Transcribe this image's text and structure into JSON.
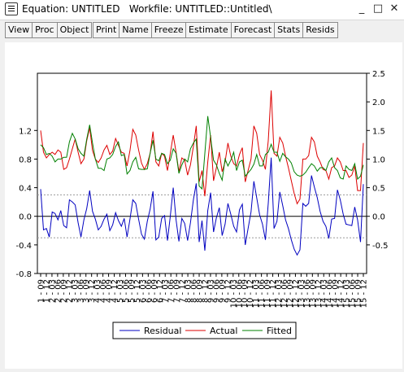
{
  "window": {
    "title": "Equation: UNTITLED   Workfile: UNTITLED::Untitled\\",
    "minimize_glyph": "_",
    "maximize_glyph": "□",
    "close_glyph": "✕"
  },
  "toolbar": {
    "group1": [
      "View",
      "Proc",
      "Object"
    ],
    "group2": [
      "Print",
      "Name",
      "Freeze"
    ],
    "group3": [
      "Estimate",
      "Forecast",
      "Stats",
      "Resids"
    ]
  },
  "colors": {
    "residual": "#0000c0",
    "actual": "#dd0000",
    "fitted": "#008000",
    "band": "#9a9a9a"
  },
  "chart_data": {
    "type": "line",
    "x_tick_labels": [
      "1 - 09",
      "1 - 12",
      "2 - 03",
      "2 - 06",
      "2 - 09",
      "2 - 12",
      "3 - 03",
      "3 - 06",
      "3 - 09",
      "3 - 12",
      "4 - 03",
      "4 - 06",
      "4 - 09",
      "4 - 12",
      "5 - 03",
      "5 - 06",
      "5 - 09",
      "5 - 12",
      "6 - 03",
      "6 - 06",
      "6 - 09",
      "6 - 12",
      "7 - 03",
      "7 - 06",
      "7 - 09",
      "7 - 12",
      "8 - 03",
      "8 - 06",
      "8 - 09",
      "8 - 12",
      "9 - 03",
      "9 - 06",
      "9 - 09",
      "9 - 12",
      "10 - 03",
      "10 - 06",
      "10 - 09",
      "10 - 12",
      "11 - 03",
      "11 - 06",
      "11 - 09",
      "11 - 12",
      "12 - 03",
      "12 - 06",
      "12 - 09",
      "12 - 12",
      "13 - 03",
      "13 - 06",
      "13 - 09",
      "13 - 12",
      "14 - 03",
      "14 - 06",
      "14 - 09",
      "14 - 12",
      "15 - 03",
      "15 - 06",
      "15 - 09",
      "15 - 12"
    ],
    "left_axis": {
      "ticks": [
        "1.2",
        "0.8",
        "0.4",
        "0.0",
        "-0.4",
        "-0.8"
      ],
      "ylim": [
        -0.8,
        2.0
      ]
    },
    "right_axis": {
      "ticks": [
        "2.5",
        "2.0",
        "1.5",
        "1.0",
        "0.5",
        "0.0",
        "-0.5"
      ],
      "ylim": [
        -1.0,
        2.5
      ]
    },
    "residual_band": [
      -0.3,
      0.3
    ],
    "series": [
      {
        "name": "Residual",
        "axis": "left",
        "values": [
          0.38,
          -0.19,
          -0.17,
          -0.29,
          0.06,
          0.04,
          -0.05,
          0.08,
          -0.13,
          -0.16,
          0.23,
          0.2,
          0.16,
          -0.09,
          -0.29,
          -0.05,
          0.11,
          0.36,
          0.07,
          -0.04,
          -0.19,
          -0.14,
          -0.04,
          0.03,
          -0.2,
          -0.12,
          0.05,
          -0.06,
          -0.14,
          -0.03,
          -0.29,
          -0.04,
          0.23,
          0.18,
          -0.04,
          -0.25,
          -0.32,
          -0.07,
          0.1,
          0.35,
          -0.33,
          -0.29,
          -0.03,
          0.01,
          -0.34,
          0.0,
          0.4,
          -0.05,
          -0.35,
          -0.03,
          -0.1,
          -0.34,
          -0.09,
          0.23,
          0.46,
          -0.36,
          -0.06,
          -0.48,
          0.08,
          0.33,
          -0.22,
          -0.02,
          0.12,
          -0.27,
          -0.11,
          0.18,
          0.03,
          -0.14,
          -0.22,
          0.09,
          0.17,
          -0.4,
          -0.17,
          0.06,
          0.49,
          0.26,
          0.02,
          -0.11,
          -0.33,
          0.18,
          0.82,
          -0.17,
          -0.07,
          0.34,
          0.15,
          -0.05,
          -0.17,
          -0.33,
          -0.46,
          -0.54,
          -0.47,
          0.18,
          0.14,
          0.18,
          0.57,
          0.41,
          0.26,
          0.07,
          -0.07,
          -0.14,
          -0.31,
          -0.04,
          -0.03,
          0.37,
          0.23,
          0.03,
          -0.11,
          -0.12,
          -0.13,
          0.13,
          -0.05,
          -0.36,
          0.45
        ]
      },
      {
        "name": "Actual",
        "axis": "right",
        "values": [
          1.5,
          1.12,
          1.02,
          1.08,
          1.12,
          1.08,
          1.16,
          1.12,
          0.82,
          0.85,
          1.0,
          1.18,
          1.35,
          1.12,
          0.92,
          1.0,
          1.32,
          1.55,
          1.15,
          1.0,
          0.94,
          1.02,
          1.16,
          1.24,
          1.08,
          1.14,
          1.36,
          1.24,
          1.12,
          1.1,
          0.88,
          1.15,
          1.52,
          1.42,
          1.16,
          0.93,
          0.82,
          0.92,
          1.1,
          1.48,
          0.95,
          0.88,
          1.1,
          1.05,
          0.8,
          1.1,
          1.42,
          1.12,
          0.78,
          1.02,
          0.98,
          0.72,
          0.9,
          1.22,
          1.58,
          0.6,
          0.8,
          0.35,
          0.95,
          1.42,
          0.62,
          0.85,
          1.12,
          0.78,
          0.95,
          1.28,
          1.05,
          0.92,
          0.88,
          1.08,
          1.2,
          0.6,
          0.8,
          1.0,
          1.58,
          1.45,
          1.08,
          0.98,
          0.82,
          1.32,
          2.2,
          1.1,
          1.05,
          1.38,
          1.28,
          1.05,
          0.85,
          0.62,
          0.4,
          0.22,
          0.3,
          1.0,
          1.0,
          1.06,
          1.38,
          1.3,
          1.05,
          0.95,
          0.82,
          0.8,
          0.65,
          0.85,
          0.88,
          1.02,
          0.95,
          0.8,
          0.8,
          0.68,
          0.72,
          0.88,
          0.45,
          0.45,
          1.28
        ]
      },
      {
        "name": "Fitted",
        "axis": "right",
        "values": [
          1.25,
          1.2,
          1.08,
          1.1,
          1.05,
          0.95,
          1.0,
          1.0,
          1.03,
          1.03,
          1.3,
          1.45,
          1.35,
          1.18,
          1.1,
          1.05,
          1.35,
          1.6,
          1.28,
          1.0,
          0.84,
          0.84,
          0.8,
          1.0,
          1.02,
          1.08,
          1.22,
          1.3,
          1.06,
          1.08,
          0.74,
          0.8,
          0.95,
          1.03,
          0.83,
          0.82,
          0.82,
          0.83,
          1.1,
          1.33,
          1.0,
          0.97,
          1.1,
          1.08,
          0.92,
          0.98,
          1.18,
          1.1,
          0.75,
          0.9,
          1.0,
          0.95,
          1.18,
          1.28,
          1.35,
          0.53,
          0.48,
          1.1,
          1.75,
          1.38,
          0.98,
          0.9,
          0.75,
          0.63,
          1.0,
          0.88,
          0.98,
          1.12,
          0.8,
          0.95,
          0.98,
          0.7,
          0.76,
          0.82,
          0.91,
          1.08,
          0.88,
          0.88,
          1.08,
          1.12,
          1.26,
          1.12,
          1.12,
          0.96,
          1.1,
          1.04,
          1.0,
          0.93,
          0.78,
          0.72,
          0.7,
          0.72,
          0.77,
          0.85,
          0.92,
          0.88,
          0.79,
          0.85,
          0.85,
          0.8,
          0.95,
          1.02,
          0.85,
          0.8,
          0.67,
          0.65,
          0.88,
          0.82,
          0.8,
          0.92,
          0.65,
          0.7,
          0.9
        ]
      }
    ],
    "legend": {
      "placement": "bottom-center"
    }
  }
}
